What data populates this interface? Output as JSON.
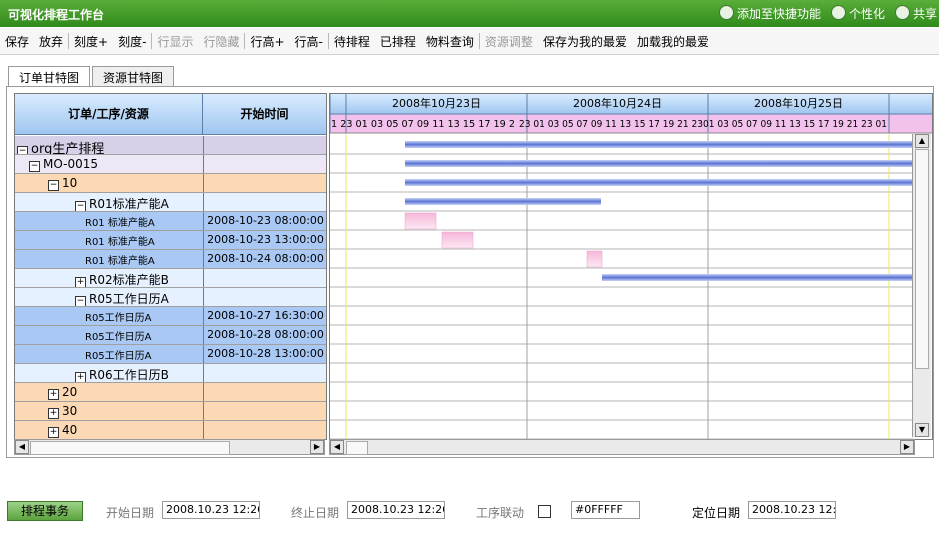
{
  "title": "可视化排程工作台",
  "header_actions": [
    "添加至快捷功能",
    "个性化",
    "共享"
  ],
  "toolbar": [
    {
      "label": "保存",
      "disabled": false
    },
    {
      "label": "放弃",
      "disabled": false
    },
    {
      "sep": true
    },
    {
      "label": "刻度+",
      "disabled": false
    },
    {
      "label": "刻度-",
      "disabled": false
    },
    {
      "sep": true
    },
    {
      "label": "行显示",
      "disabled": true
    },
    {
      "label": "行隐藏",
      "disabled": true
    },
    {
      "sep": true
    },
    {
      "label": "行高+",
      "disabled": false
    },
    {
      "label": "行高-",
      "disabled": false
    },
    {
      "sep": true
    },
    {
      "label": "待排程",
      "disabled": false
    },
    {
      "label": "已排程",
      "disabled": false
    },
    {
      "label": "物料查询",
      "disabled": false
    },
    {
      "sep": true
    },
    {
      "label": "资源调整",
      "disabled": true
    },
    {
      "label": "保存为我的最爱",
      "disabled": false
    },
    {
      "label": "加载我的最爱",
      "disabled": false
    }
  ],
  "tabs": [
    "订单甘特图",
    "资源甘特图"
  ],
  "grid": {
    "col_task": "订单/工序/资源",
    "col_start": "开始时间",
    "rows": [
      {
        "label": "org生产排程",
        "level": 0,
        "toggle": "minus",
        "start": "",
        "color": "#d8d0e8"
      },
      {
        "label": "MO-0015",
        "level": 1,
        "toggle": "minus",
        "start": "",
        "color": "#ede7f6"
      },
      {
        "label": "10",
        "level": 2,
        "toggle": "minus",
        "start": "",
        "color": "#fbd9b5"
      },
      {
        "label": "R01标准产能A",
        "level": 3,
        "toggle": "minus",
        "start": "",
        "color": "#e6f1ff"
      },
      {
        "label": "R01 标准产能A",
        "level": 4,
        "toggle": "",
        "start": "2008-10-23 08:00:00",
        "color": "#a9c8f4"
      },
      {
        "label": "R01 标准产能A",
        "level": 4,
        "toggle": "",
        "start": "2008-10-23 13:00:00",
        "color": "#a9c8f4"
      },
      {
        "label": "R01 标准产能A",
        "level": 4,
        "toggle": "",
        "start": "2008-10-24 08:00:00",
        "color": "#a9c8f4"
      },
      {
        "label": "R02标准产能B",
        "level": 3,
        "toggle": "plus",
        "start": "",
        "color": "#e6f1ff"
      },
      {
        "label": "R05工作日历A",
        "level": 3,
        "toggle": "minus",
        "start": "",
        "color": "#e6f1ff"
      },
      {
        "label": "R05工作日历A",
        "level": 4,
        "toggle": "",
        "start": "2008-10-27 16:30:00",
        "color": "#a9c8f4"
      },
      {
        "label": "R05工作日历A",
        "level": 4,
        "toggle": "",
        "start": "2008-10-28 08:00:00",
        "color": "#a9c8f4"
      },
      {
        "label": "R05工作日历A",
        "level": 4,
        "toggle": "",
        "start": "2008-10-28 13:00:00",
        "color": "#a9c8f4"
      },
      {
        "label": "R06工作日历B",
        "level": 3,
        "toggle": "plus",
        "start": "",
        "color": "#e6f1ff"
      },
      {
        "label": "20",
        "level": 2,
        "toggle": "plus",
        "start": "",
        "color": "#fbd9b5"
      },
      {
        "label": "30",
        "level": 2,
        "toggle": "plus",
        "start": "",
        "color": "#fbd9b5"
      },
      {
        "label": "40",
        "level": 2,
        "toggle": "plus",
        "start": "",
        "color": "#fbd9b5"
      }
    ]
  },
  "gantt": {
    "dates": [
      "2008年10月23日",
      "2008年10月24日",
      "2008年10月25日"
    ],
    "hours_left": "1 23 01 03 05 07 09 11 13 15 17 19 2",
    "hours_mid": "23 01 03 05 07 09 11 13 15 17 19 21 23",
    "hours_right": "01 03 05 07 09 11 13 15 17 19 21 23 01"
  },
  "bottom": {
    "schedule_button": "排程事务",
    "start_date_label": "开始日期",
    "start_date_value": "2008.10.23 12:26",
    "end_date_label": "终止日期",
    "end_date_value": "2008.10.23 12:26",
    "link_label": "工序联动",
    "color_value": "#0FFFFF",
    "locate_label": "定位日期",
    "locate_value": "2008.10.23 12:"
  }
}
